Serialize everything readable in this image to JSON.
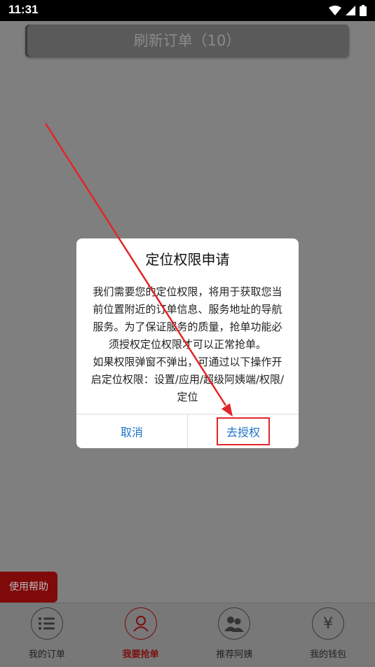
{
  "status_bar": {
    "time": "11:31"
  },
  "header": {
    "refresh_label": "刷新订单（10）"
  },
  "dialog": {
    "title": "定位权限申请",
    "body_lines": [
      "我们需要您的定位权限，将用于获取您当",
      "前位置附近的订单信息、服务地址的导航",
      "服务。为了保证服务的质量，抢单功能必",
      "须授权定位权限才可以正常抢单。",
      "如果权限弹窗不弹出，可通过以下操作开",
      "启定位权限：设置/应用/超级阿姨端/权限/",
      "定位"
    ],
    "cancel_label": "取消",
    "authorize_label": "去授权"
  },
  "help": {
    "label": "使用帮助"
  },
  "bottom_nav": {
    "items": [
      {
        "label": "我的订单",
        "icon": "list-icon",
        "active": false
      },
      {
        "label": "我要抢单",
        "icon": "person-icon",
        "active": true
      },
      {
        "label": "推荐阿姨",
        "icon": "people-icon",
        "active": false
      },
      {
        "label": "我的钱包",
        "icon": "yen-icon",
        "active": false
      }
    ],
    "yen_glyph": "¥"
  },
  "colors": {
    "overlay": "#7f7f7f",
    "accent_red": "#e1262a",
    "link_blue": "#1e73c8",
    "active_nav": "#7a0f0f"
  }
}
